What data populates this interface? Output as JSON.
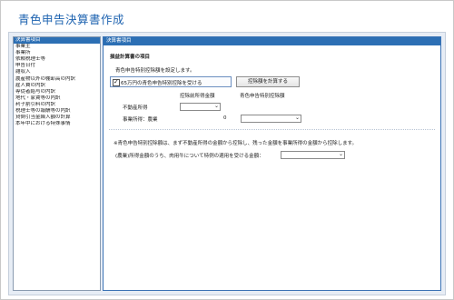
{
  "app_title": "青色申告決算書作成",
  "nav": {
    "items": [
      {
        "label": "決算書項目",
        "selected": true
      },
      {
        "label": "事業主",
        "selected": false
      },
      {
        "label": "事業所",
        "selected": false
      },
      {
        "label": "依頼税理士等",
        "selected": false
      },
      {
        "label": "申告日付",
        "selected": false
      },
      {
        "label": "雑収入",
        "selected": false
      },
      {
        "label": "農産物以外の棚卸高の内訳",
        "selected": false
      },
      {
        "label": "雇人費の内訳",
        "selected": false
      },
      {
        "label": "専従者給与の内訳",
        "selected": false
      },
      {
        "label": "地代・家賃等の内訳",
        "selected": false
      },
      {
        "label": "利子割引料の内訳",
        "selected": false
      },
      {
        "label": "税理士等の報酬等の内訳",
        "selected": false
      },
      {
        "label": "貸倒引当金繰入額の計算",
        "selected": false
      },
      {
        "label": "本年中における特殊事情",
        "selected": false
      }
    ]
  },
  "panel": {
    "header": "決算書項目",
    "section_title": "損益計算書の項目",
    "instruction": "青色申告特別控除額を設定します。",
    "checkbox": {
      "label": "65万円の青色申告特別控除を受ける",
      "checked": true
    },
    "calc_button": "控除額を計算する",
    "col_before": "控除前所得金額",
    "col_deduction": "青色申告特別控除額",
    "rows": [
      {
        "label": "不動産所得",
        "before_value": "",
        "deduction_value": ""
      },
      {
        "label": "事業所得：農業",
        "before_value": "0",
        "deduction_value": ""
      }
    ],
    "note": "※青色申告特別控除額は、まず不動産所得の金額から控除し、残った金額を事業所得の金額から控除します。",
    "special_label": "(農業)所得金額のうち、肉用牛について特例の適用を受ける金額：",
    "special_value": ""
  }
}
